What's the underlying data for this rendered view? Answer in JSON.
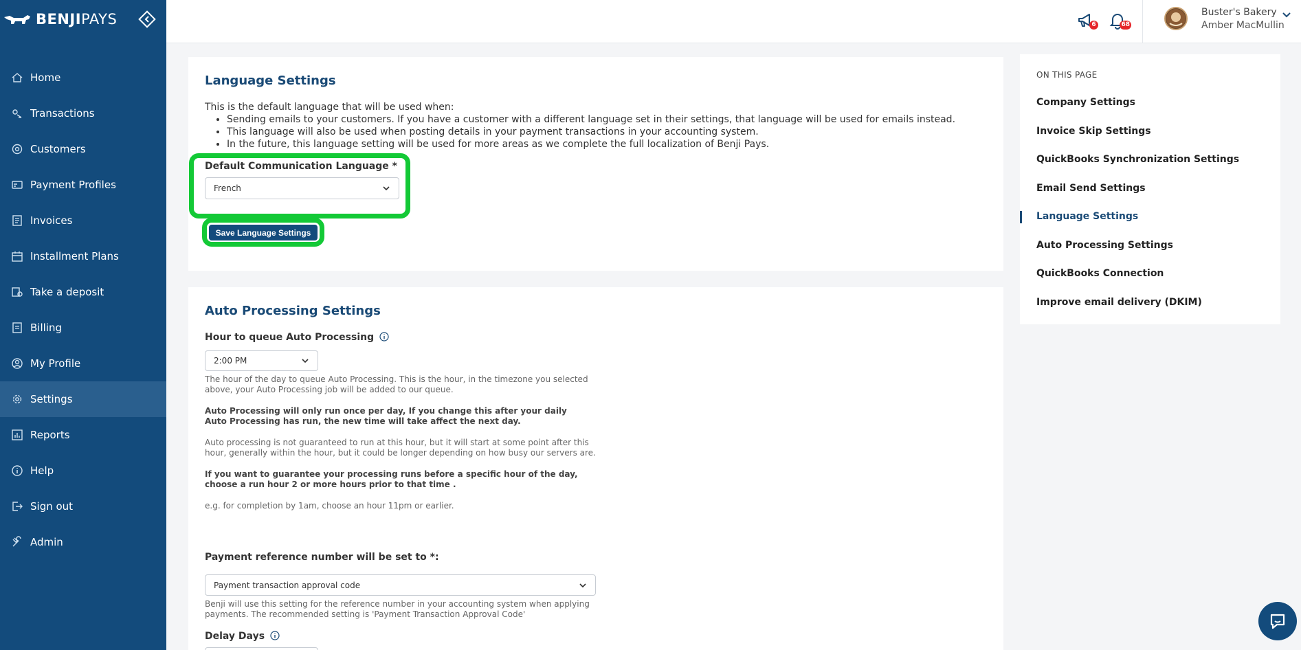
{
  "brand": {
    "name_bold": "BENJI",
    "name_light": "PAYS"
  },
  "sidebar": {
    "items": [
      {
        "label": "Home",
        "icon": "home-icon"
      },
      {
        "label": "Transactions",
        "icon": "transactions-icon"
      },
      {
        "label": "Customers",
        "icon": "customers-icon"
      },
      {
        "label": "Payment Profiles",
        "icon": "payment-profiles-icon"
      },
      {
        "label": "Invoices",
        "icon": "invoices-icon"
      },
      {
        "label": "Installment Plans",
        "icon": "calendar-icon"
      },
      {
        "label": "Take a deposit",
        "icon": "deposit-icon"
      },
      {
        "label": "Billing",
        "icon": "billing-icon"
      },
      {
        "label": "My Profile",
        "icon": "profile-icon"
      },
      {
        "label": "Settings",
        "icon": "gear-icon",
        "active": true
      },
      {
        "label": "Reports",
        "icon": "reports-icon"
      },
      {
        "label": "Help",
        "icon": "help-icon"
      },
      {
        "label": "Sign out",
        "icon": "sign-out-icon"
      },
      {
        "label": "Admin",
        "icon": "admin-icon"
      }
    ]
  },
  "header": {
    "announcements_count": "6",
    "notifications_count": "68",
    "company": "Buster's Bakery",
    "user": "Amber MacMullin"
  },
  "language": {
    "title": "Language Settings",
    "intro": "This is the default language that will be used when:",
    "bullets": [
      "Sending emails to your customers. If you have a customer with a different language set in their settings, that language will be used for emails instead.",
      "This language will also be used when posting details in your payment transactions in your accounting system.",
      "In the future, this language setting will be used for more areas as we complete the full localization of Benji Pays."
    ],
    "field_label": "Default Communication Language *",
    "selected": "French",
    "save_label": "Save Language Settings"
  },
  "auto": {
    "title": "Auto Processing Settings",
    "hour_label": "Hour to queue Auto Processing",
    "hour_value": "2:00 PM",
    "help1": "The hour of the day to queue Auto Processing. This is the hour, in the timezone you selected above, your Auto Processing job will be added to our queue.",
    "help2": "Auto Processing will only run once per day, If you change this after your daily Auto Processing has run, the new time will take affect the next day.",
    "help3": "Auto processing is not guaranteed to run at this hour, but it will start at some point after this hour, generally within the hour, but it could be longer depending on how busy our servers are.",
    "help4": "If you want to guarantee your processing runs before a specific hour of the day, choose a run hour 2 or more hours prior to that time .",
    "help5": "e.g. for completion by 1am, choose an hour 11pm or earlier.",
    "ref_label": "Payment reference number will be set to *:",
    "ref_value": "Payment transaction approval code",
    "ref_help": "Benji will use this setting for the reference number in your accounting system when applying payments. The recommended setting is 'Payment Transaction Approval Code'",
    "delay_label": "Delay Days"
  },
  "toc": {
    "heading": "ON THIS PAGE",
    "items": [
      "Company Settings",
      "Invoice Skip Settings",
      "QuickBooks Synchronization Settings",
      "Email Send Settings",
      "Language Settings",
      "Auto Processing Settings",
      "QuickBooks Connection",
      "Improve email delivery (DKIM)"
    ],
    "active_index": 4
  },
  "colors": {
    "sidebar": "#134b7c",
    "highlight": "#13c936",
    "heading": "#1a4a76",
    "badge": "#e5252a"
  }
}
